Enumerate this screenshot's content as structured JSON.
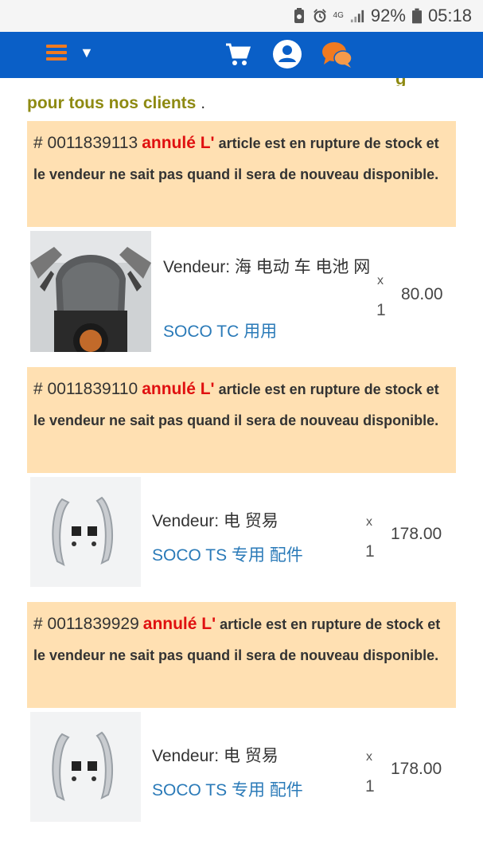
{
  "status_bar": {
    "network": "4G",
    "battery": "92%",
    "time": "05:18"
  },
  "header": {
    "menu_icon": "hamburger-menu-icon",
    "caret_icon": "caret-down-icon",
    "cart_icon": "cart-icon",
    "account_icon": "account-icon",
    "chat_icon": "chat-icon",
    "brand_color": "#0a5fc7",
    "accent_color": "#f07a20"
  },
  "intro": {
    "line_fragment": "g",
    "text": "pour tous nos clients",
    "dot": "."
  },
  "orders": [
    {
      "number": "# 0011839113",
      "status": "annulé L'",
      "message": " article est en rupture de stock et le vendeur ne sait pas quand il sera de nouveau disponible.",
      "vendor_label": "Vendeur: 海 电动 车 电池 网",
      "product": "SOCO TC 用用",
      "qty_x": "x",
      "qty": "1",
      "price": "80.00"
    },
    {
      "number": "# 0011839110",
      "status": "annulé L'",
      "message": " article est en rupture de stock et le vendeur ne sait pas quand il sera de nouveau disponible.",
      "vendor_label": "Vendeur: 电 贸易",
      "product": "SOCO TS 专用 配件",
      "qty_x": "x",
      "qty": "1",
      "price": "178.00"
    },
    {
      "number": "# 0011839929",
      "status": "annulé L'",
      "message": " article est en rupture de stock et le vendeur ne sait pas quand il sera de nouveau disponible.",
      "vendor_label": "Vendeur: 电 贸易",
      "product": "SOCO TS 专用 配件",
      "qty_x": "x",
      "qty": "1",
      "price": "178.00"
    }
  ]
}
